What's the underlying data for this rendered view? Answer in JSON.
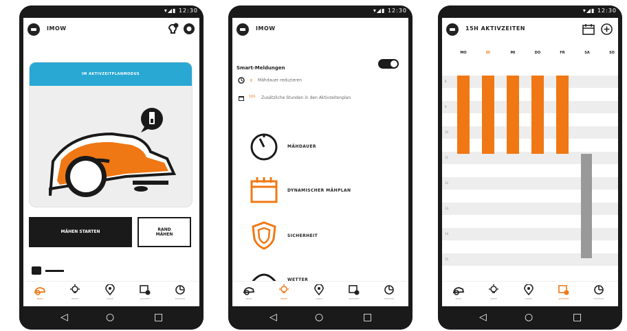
{
  "status": {
    "time": "12:30",
    "icons": [
      "wifi-icon",
      "signal-icon",
      "battery-icon"
    ]
  },
  "screen1": {
    "title": "IMOW",
    "status_banner": "IM AKTIVZEITPLANMODUS",
    "start_button": "MÄHEN STARTEN",
    "edge_button": "RAND\nMÄHEN",
    "battery_level": 0.45,
    "tabs": [
      {
        "label": "IMOW",
        "icon": "mower-icon",
        "active": true
      },
      {
        "label": "SMART",
        "icon": "bulb-icon",
        "active": false
      },
      {
        "label": "KARTE",
        "icon": "location-icon",
        "active": false
      },
      {
        "label": "AKTIVZEIT",
        "icon": "calendar-mower-icon",
        "active": false
      },
      {
        "label": "STATISTIK",
        "icon": "chart-icon",
        "active": false
      }
    ]
  },
  "screen2": {
    "title": "IMOW",
    "smart_label": "Smart-Meldungen",
    "notices": [
      {
        "icon": "clock-icon",
        "value": "8",
        "text": "Mähdauer reduzieren"
      },
      {
        "icon": "calendar-icon",
        "value": "10h",
        "text": "Zusätzliche Stunden in den Aktivzeitenplan"
      }
    ],
    "features": [
      {
        "label": "MÄHDAUER",
        "icon": "timer-icon"
      },
      {
        "label": "DYNAMISCHER MÄHPLAN",
        "icon": "calendar-icon"
      },
      {
        "label": "SICHERHEIT",
        "icon": "shield-icon"
      },
      {
        "label": "WETTER",
        "icon": "umbrella-icon"
      }
    ],
    "tabs": [
      {
        "label": "IMOW",
        "icon": "mower-icon",
        "active": false
      },
      {
        "label": "SMART",
        "icon": "bulb-icon",
        "active": true
      },
      {
        "label": "KARTE",
        "icon": "location-icon",
        "active": false
      },
      {
        "label": "AKTIVZEIT",
        "icon": "calendar-mower-icon",
        "active": false
      },
      {
        "label": "STATISTIK",
        "icon": "chart-icon",
        "active": false
      }
    ]
  },
  "screen3": {
    "title": "15H AKTIVZEITEN",
    "days": [
      "MO",
      "DI",
      "MI",
      "DO",
      "FR",
      "SA",
      "SO"
    ],
    "active_day": "DI",
    "hours": [
      "8",
      "9",
      "10",
      "11",
      "12",
      "13",
      "14",
      "15"
    ],
    "tabs": [
      {
        "label": "IMOW",
        "icon": "mower-icon",
        "active": false
      },
      {
        "label": "SMART",
        "icon": "bulb-icon",
        "active": false
      },
      {
        "label": "KARTE",
        "icon": "location-icon",
        "active": false
      },
      {
        "label": "AKTIVZEIT",
        "icon": "calendar-mower-icon",
        "active": true
      },
      {
        "label": "STATISTIK",
        "icon": "chart-icon",
        "active": false
      }
    ]
  }
}
